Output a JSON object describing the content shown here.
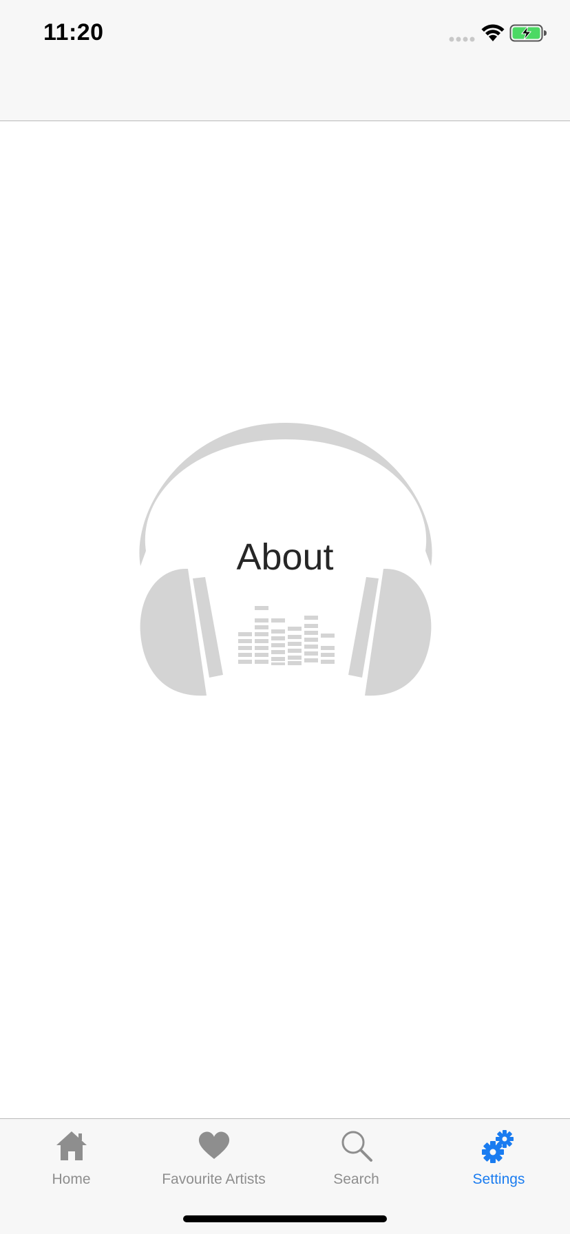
{
  "status_bar": {
    "time": "11:20",
    "icons": [
      "signal-dots-icon",
      "wifi-icon",
      "battery-charging-icon"
    ]
  },
  "about": {
    "title": "About",
    "graphic": "headphones-equalizer-icon"
  },
  "tab_bar": {
    "active_color": "#1a7cf0",
    "inactive_color": "#8e8e8e",
    "tabs": [
      {
        "label": "Home",
        "icon": "home-icon",
        "active": false
      },
      {
        "label": "Favourite Artists",
        "icon": "heart-icon",
        "active": false
      },
      {
        "label": "Search",
        "icon": "search-icon",
        "active": false
      },
      {
        "label": "Settings",
        "icon": "gears-icon",
        "active": true
      }
    ]
  }
}
